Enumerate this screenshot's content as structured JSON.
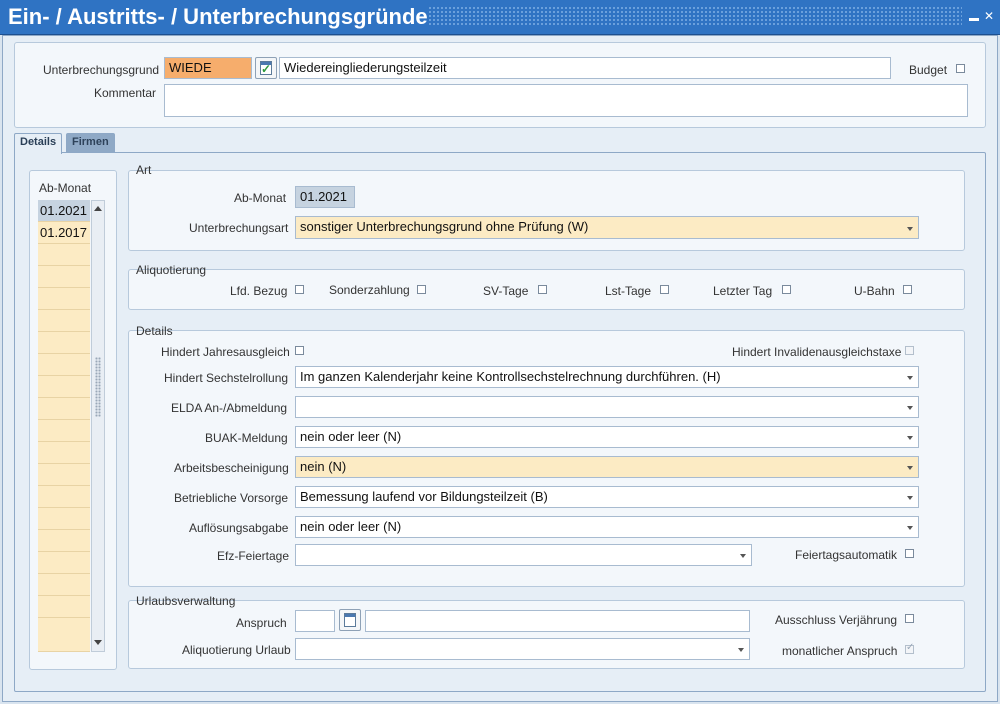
{
  "window": {
    "title": "Ein- / Austritts- / Unterbrechungsgründe"
  },
  "header": {
    "unterbrechungsgrund_label": "Unterbrechungsgrund",
    "unterbrechungsgrund_code": "WIEDE",
    "unterbrechungsgrund_text": "Wiedereingliederungsteilzeit",
    "budget_label": "Budget",
    "kommentar_label": "Kommentar",
    "kommentar_value": ""
  },
  "tabs": [
    {
      "label": "Details"
    },
    {
      "label": "Firmen"
    }
  ],
  "ab_monat_list": {
    "header": "Ab-Monat",
    "items": [
      "01.2021",
      "01.2017"
    ]
  },
  "art": {
    "title": "Art",
    "ab_monat_label": "Ab-Monat",
    "ab_monat_value": "01.2021",
    "unterbrechungsart_label": "Unterbrechungsart",
    "unterbrechungsart_value": "sonstiger Unterbrechungsgrund ohne Prüfung (W)"
  },
  "aliquotierung": {
    "title": "Aliquotierung",
    "items": [
      "Lfd. Bezug",
      "Sonderzahlung",
      "SV-Tage",
      "Lst-Tage",
      "Letzter Tag",
      "U-Bahn"
    ]
  },
  "details": {
    "title": "Details",
    "hindert_jahresausgleich": "Hindert Jahresausgleich",
    "hindert_invalidenausgleichstaxe": "Hindert Invalidenausgleichstaxe",
    "hindert_sechstelrollung_label": "Hindert Sechstelrollung",
    "hindert_sechstelrollung_value": "Im ganzen Kalenderjahr keine Kontrollsechstelrechnung durchführen. (H)",
    "elda_label": "ELDA An-/Abmeldung",
    "elda_value": "",
    "buak_label": "BUAK-Meldung",
    "buak_value": "nein oder leer (N)",
    "arbeitsbescheinigung_label": "Arbeitsbescheinigung",
    "arbeitsbescheinigung_value": "nein (N)",
    "betriebliche_vorsorge_label": "Betriebliche Vorsorge",
    "betriebliche_vorsorge_value": "Bemessung laufend vor Bildungsteilzeit (B)",
    "aufloesungsabgabe_label": "Auflösungsabgabe",
    "aufloesungsabgabe_value": "nein oder leer (N)",
    "efz_feiertage_label": "Efz-Feiertage",
    "efz_feiertage_value": "",
    "feiertagsautomatik_label": "Feiertagsautomatik"
  },
  "urlaub": {
    "title": "Urlaubsverwaltung",
    "anspruch_label": "Anspruch",
    "anspruch_value": "",
    "anspruch_text": "",
    "ausschluss_label": "Ausschluss Verjährung",
    "aliquotierung_label": "Aliquotierung Urlaub",
    "aliquotierung_value": "",
    "monatlicher_label": "monatlicher Anspruch"
  }
}
